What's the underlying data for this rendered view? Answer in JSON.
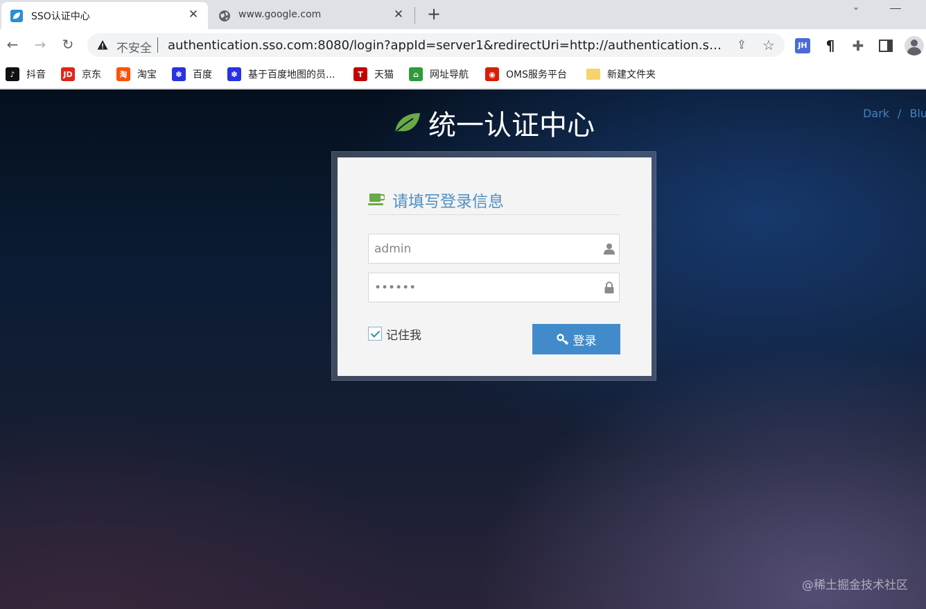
{
  "browser": {
    "tabs": [
      {
        "title": "SSO认证中心",
        "active": true
      },
      {
        "title": "www.google.com",
        "active": false
      }
    ],
    "omnibox": {
      "security_text": "不安全",
      "url": "authentication.sso.com:8080/login?appId=server1&redirectUri=http://authentication.sso.com:..."
    },
    "extensions": {
      "jh_label": "JH"
    },
    "bookmarks": [
      {
        "label": "抖音",
        "icon": "douyin-icon",
        "color": "#111111",
        "glyph": "♪"
      },
      {
        "label": "京东",
        "icon": "jd-icon",
        "color": "#e1251b",
        "glyph": "JD"
      },
      {
        "label": "淘宝",
        "icon": "taobao-icon",
        "color": "#ff5000",
        "glyph": "淘"
      },
      {
        "label": "百度",
        "icon": "baidu-icon",
        "color": "#2932e1",
        "glyph": "✽"
      },
      {
        "label": "基于百度地图的员...",
        "icon": "baidu-icon",
        "color": "#2932e1",
        "glyph": "✽"
      },
      {
        "label": "天猫",
        "icon": "tmall-icon",
        "color": "#c40000",
        "glyph": "T"
      },
      {
        "label": "网址导航",
        "icon": "2345-icon",
        "color": "#2f9a3a",
        "glyph": "⌂"
      },
      {
        "label": "OMS服务平台",
        "icon": "oms-icon",
        "color": "#d81e06",
        "glyph": "◉"
      },
      {
        "label": "新建文件夹",
        "icon": "folder-icon",
        "color": "#f6d36b",
        "glyph": ""
      }
    ]
  },
  "page": {
    "skin": {
      "dark": "Dark",
      "sep": "/",
      "blue": "Blu"
    },
    "brand_title": "统一认证中心",
    "login": {
      "header": "请填写登录信息",
      "username_value": "admin",
      "password_value": "123456",
      "remember_label": "记住我",
      "remember_checked": true,
      "submit_label": "登录"
    },
    "watermark": "@稀土掘金技术社区"
  },
  "colors": {
    "accent": "#428bca",
    "header_text": "#5090c1",
    "leaf": "#69aa46"
  }
}
